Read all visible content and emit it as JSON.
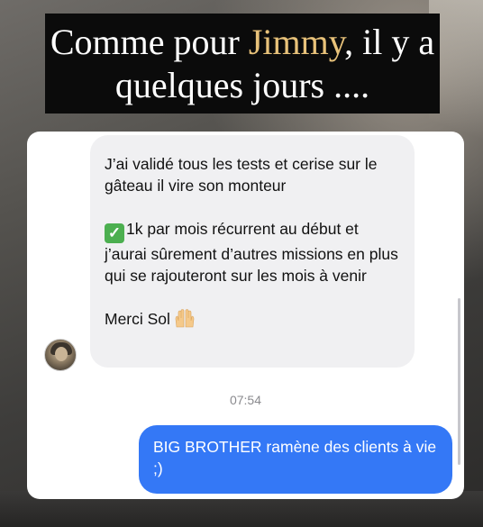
{
  "caption": {
    "prefix": "Comme pour ",
    "name": "Jimmy",
    "suffix": ", il y a quelques jours ...."
  },
  "conversation": {
    "incoming": {
      "line1": "J’ai validé tous les tests et cerise sur le gâteau il vire son monteur",
      "check_emoji": "✓",
      "line2": "1k par mois récurrent au début et j’aurai sûrement d’autres missions en plus qui se rajouteront sur les mois à venir",
      "line3": "Merci Sol"
    },
    "timestamp": "07:54",
    "outgoing": {
      "text": "BIG BROTHER ramène des clients à vie ;)"
    }
  },
  "colors": {
    "outgoing_bubble": "#3478f6",
    "incoming_bubble": "#f0f0f2",
    "caption_name": "#e8c27a"
  },
  "icons": {
    "check": "white-check-mark-icon",
    "hands": "raising-hands-icon"
  }
}
